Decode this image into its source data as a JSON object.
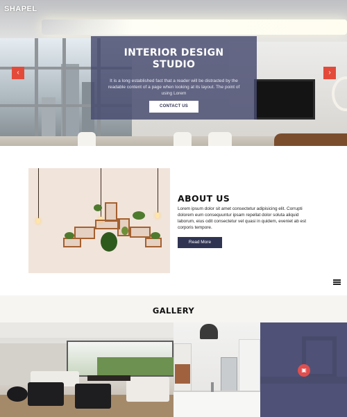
{
  "brand": {
    "logo": "SHAPEL"
  },
  "hero": {
    "title_line1": "INTERIOR DESIGN",
    "title_line2": "STUDIO",
    "text": "It is a long established fact that a reader will be distracted by the readable content of a page when looking at its layout. The point of using Lorem",
    "button": "CONTACT US",
    "prev_icon": "arrow-left-icon",
    "next_icon": "arrow-right-icon",
    "prev_glyph": "‹",
    "next_glyph": "›",
    "accent_color": "#e34a3a",
    "card_color": "#46496e"
  },
  "about": {
    "title": "ABOUT US",
    "text": "Lorem ipsum dolor sit amet consectetur adipisicing elit. Corrupti dolorem eum consequuntur ipsam repellat dolor soluta aliquid laborum, eius odit consectetur vel quasi in quidem, eveniet ab est corporis tempore.",
    "button": "Read More",
    "button_color": "#2f3452",
    "menu_icon": "hamburger-menu-icon"
  },
  "gallery": {
    "title": "GALLERY",
    "badge_icon": "image-icon",
    "badge_glyph": "▣"
  }
}
